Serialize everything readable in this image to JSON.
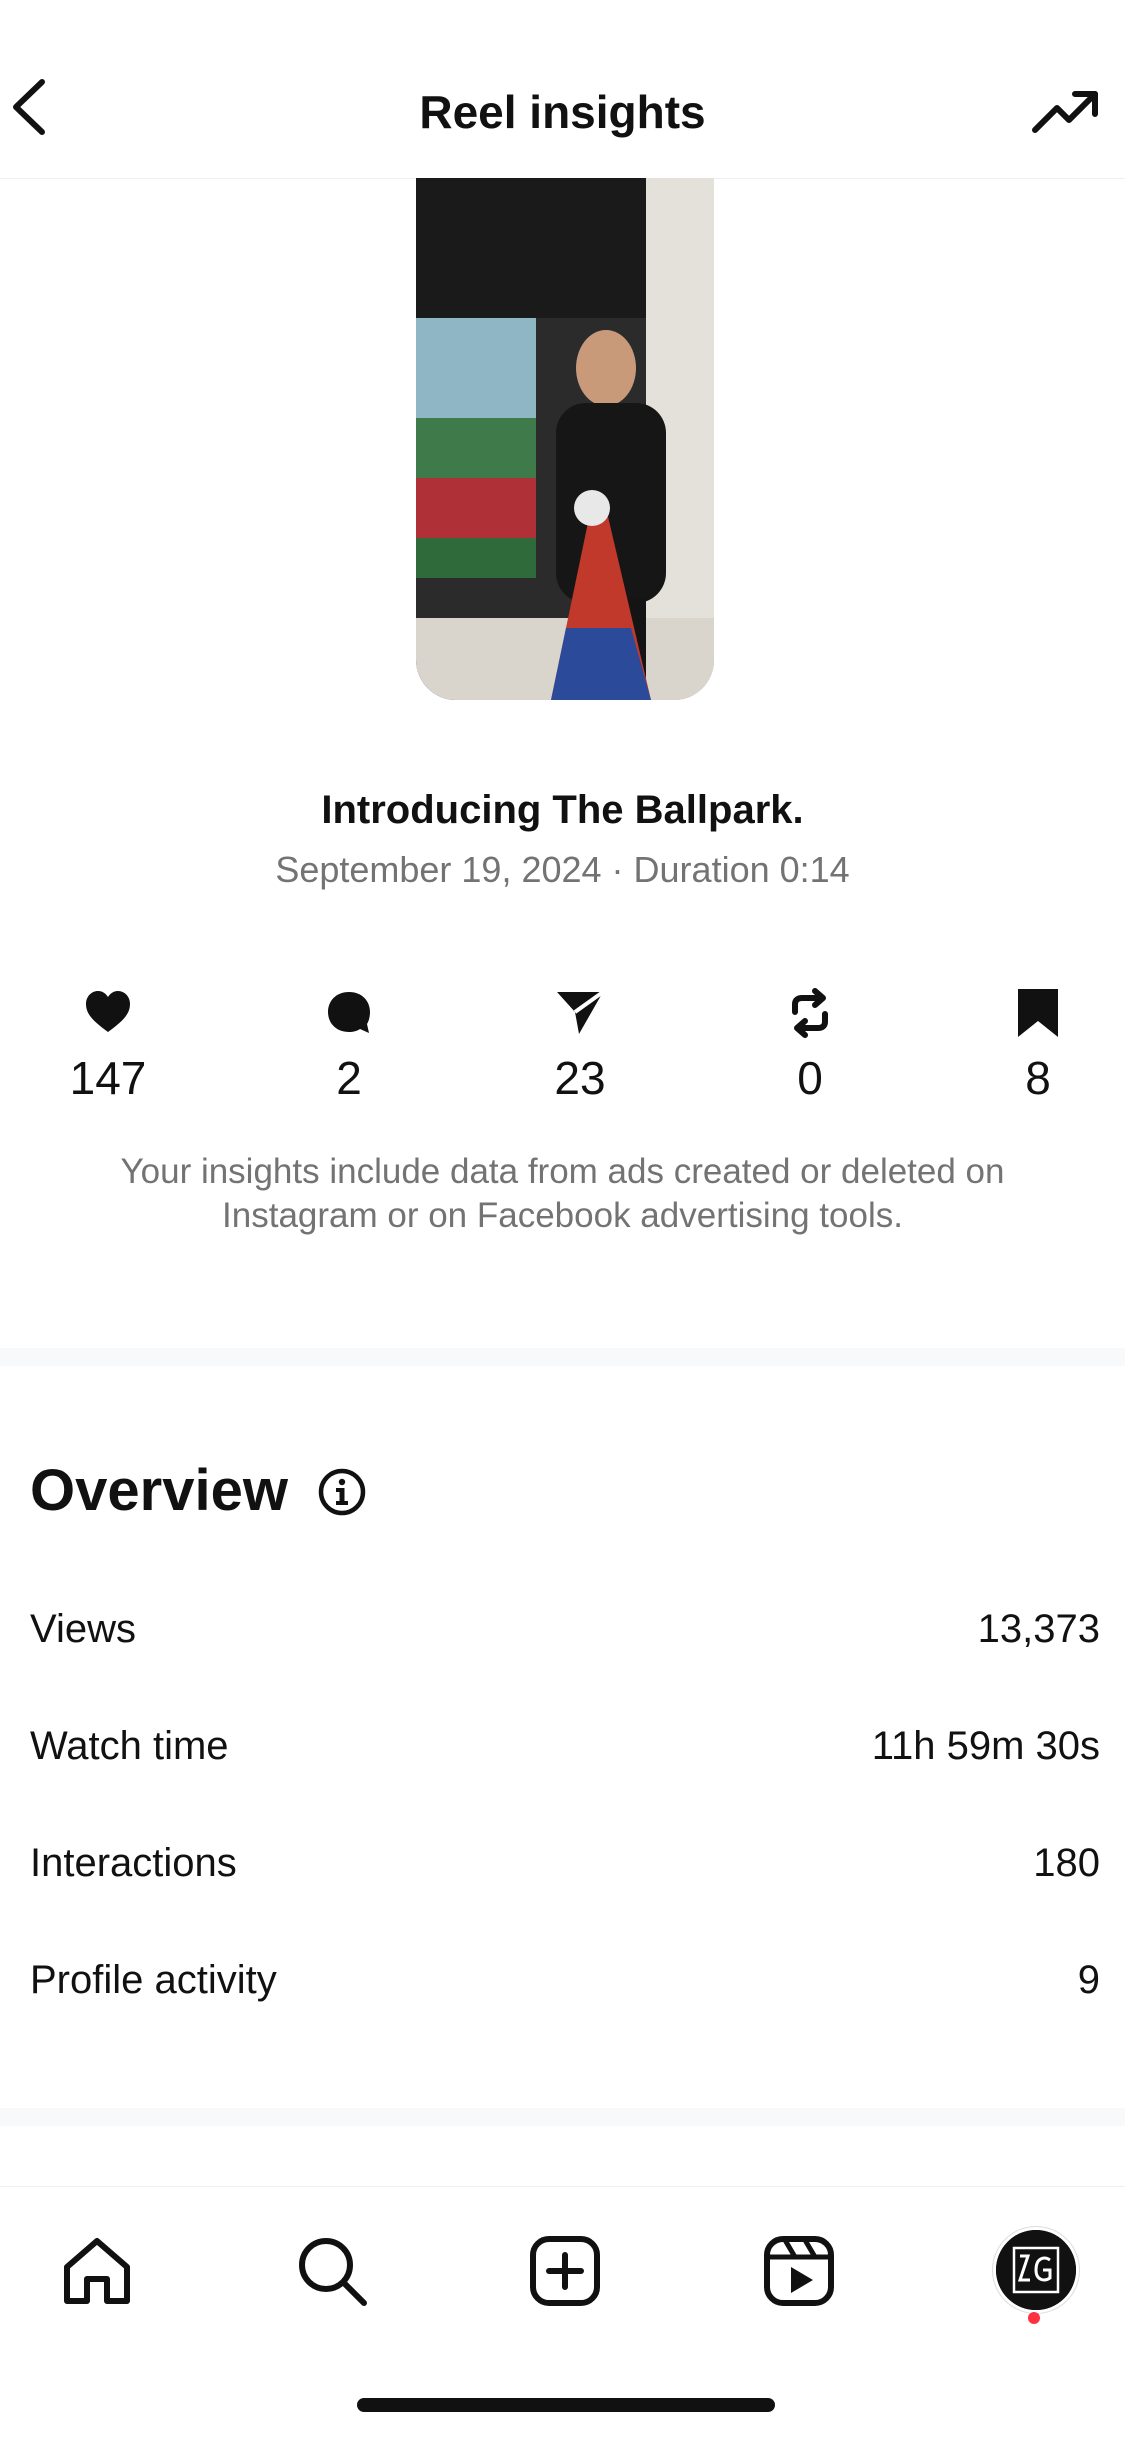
{
  "header": {
    "title": "Reel insights",
    "back_icon": "chevron-left-icon",
    "trend_icon": "trending-up-icon"
  },
  "reel": {
    "title": "Introducing The Ballpark.",
    "meta": "September 19, 2024 · Duration 0:14"
  },
  "stats": [
    {
      "name": "likes",
      "icon": "heart-icon",
      "value": "147"
    },
    {
      "name": "comments",
      "icon": "comment-icon",
      "value": "2"
    },
    {
      "name": "shares",
      "icon": "send-icon",
      "value": "23"
    },
    {
      "name": "reposts",
      "icon": "repost-icon",
      "value": "0"
    },
    {
      "name": "saves",
      "icon": "bookmark-icon",
      "value": "8"
    }
  ],
  "disclaimer": "Your insights include data from ads created or deleted on Instagram or on Facebook advertising tools.",
  "overview": {
    "title": "Overview",
    "rows": [
      {
        "label": "Views",
        "value": "13,373"
      },
      {
        "label": "Watch time",
        "value": "11h 59m 30s"
      },
      {
        "label": "Interactions",
        "value": "180"
      },
      {
        "label": "Profile activity",
        "value": "9"
      }
    ]
  },
  "tabbar": {
    "items": [
      "home-icon",
      "search-icon",
      "create-icon",
      "reels-icon",
      "profile-avatar"
    ]
  },
  "colors": {
    "text": "#111111",
    "secondary": "#737373",
    "notification": "#ff3040"
  }
}
